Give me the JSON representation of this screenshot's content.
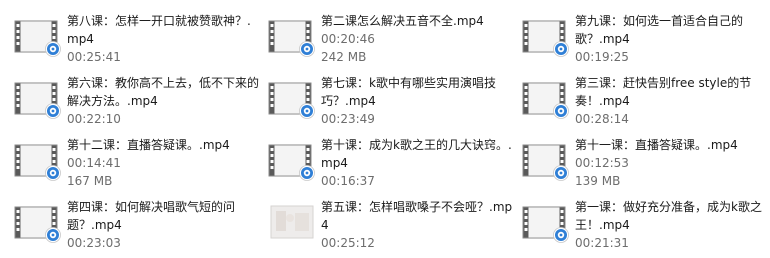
{
  "files": [
    {
      "name": "第八课：怎样一开口就被赞歌神？.mp4",
      "duration": "00:25:41",
      "size": "",
      "thumb": "film-icon"
    },
    {
      "name": "第二课怎么解决五音不全.mp4",
      "duration": "00:20:46",
      "size": "242 MB",
      "thumb": "film-icon"
    },
    {
      "name": "第九课：如何选一首适合自己的歌？.mp4",
      "duration": "00:19:25",
      "size": "",
      "thumb": "film-icon"
    },
    {
      "name": "第六课：教你高不上去，低不下来的解决方法。.mp4",
      "duration": "00:22:10",
      "size": "",
      "thumb": "film-icon"
    },
    {
      "name": "第七课：k歌中有哪些实用演唱技巧？.mp4",
      "duration": "00:23:49",
      "size": "",
      "thumb": "film-icon"
    },
    {
      "name": "第三课：赶快告别free style的节奏！.mp4",
      "duration": "00:28:14",
      "size": "",
      "thumb": "film-icon"
    },
    {
      "name": "第十二课：直播答疑课。.mp4",
      "duration": "00:14:41",
      "size": "167 MB",
      "thumb": "film-icon"
    },
    {
      "name": "第十课：成为k歌之王的几大诀窍。.mp4",
      "duration": "00:16:37",
      "size": "",
      "thumb": "film-icon"
    },
    {
      "name": "第十一课：直播答疑课。.mp4",
      "duration": "00:12:53",
      "size": "139 MB",
      "thumb": "film-icon"
    },
    {
      "name": "第四课：如何解决唱歌气短的问题？.mp4",
      "duration": "00:23:03",
      "size": "",
      "thumb": "film-icon"
    },
    {
      "name": "第五课：怎样唱歌嗓子不会哑？.mp4",
      "duration": "00:25:12",
      "size": "",
      "thumb": "video-preview-thumbnail"
    },
    {
      "name": "第一课：做好充分准备，成为k歌之王！.mp4",
      "duration": "00:21:31",
      "size": "",
      "thumb": "film-icon"
    }
  ]
}
